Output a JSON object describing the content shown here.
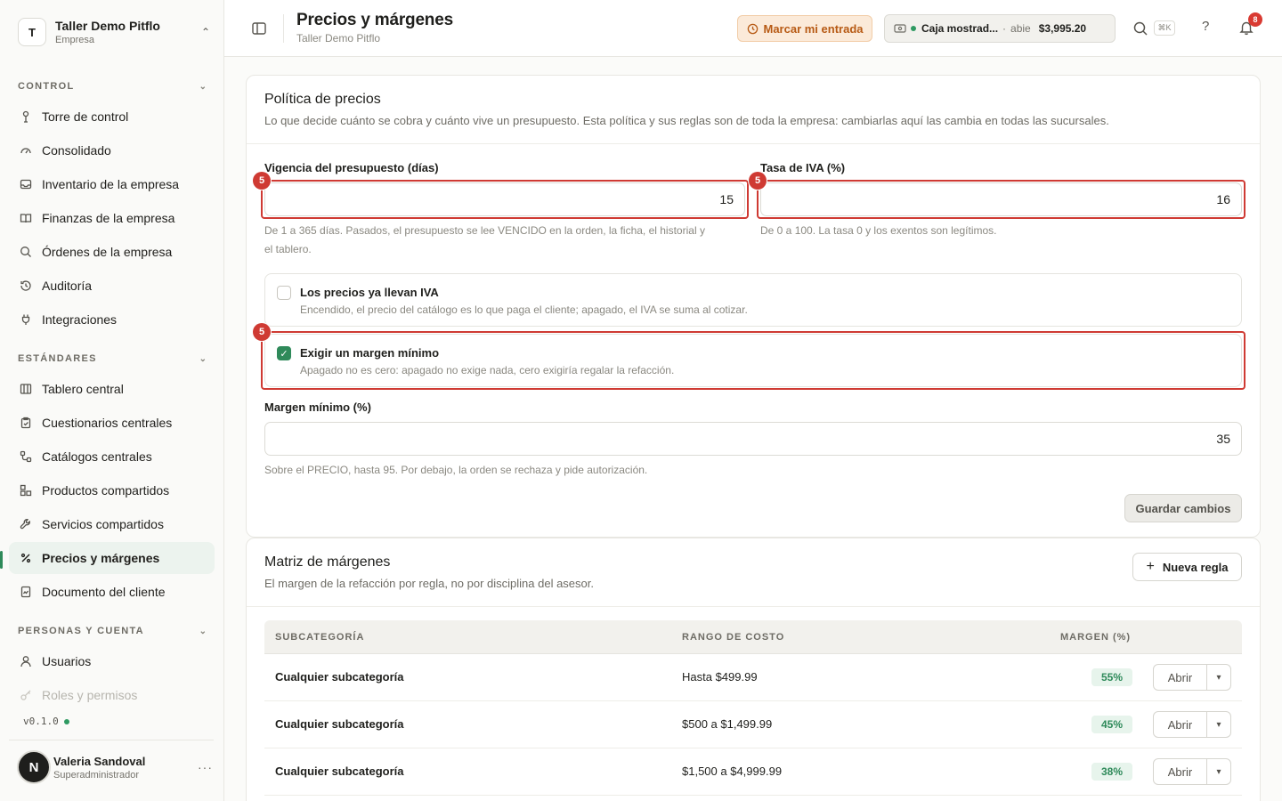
{
  "workspace": {
    "initial": "T",
    "name": "Taller Demo Pitflo",
    "type": "Empresa"
  },
  "sidebar": {
    "sections": [
      {
        "title": "CONTROL",
        "items": [
          {
            "label": "Torre de control",
            "icon": "tower-icon"
          },
          {
            "label": "Consolidado",
            "icon": "gauge-icon"
          },
          {
            "label": "Inventario de la empresa",
            "icon": "inbox-icon"
          },
          {
            "label": "Finanzas de la empresa",
            "icon": "book-icon"
          },
          {
            "label": "Órdenes de la empresa",
            "icon": "search-icon"
          },
          {
            "label": "Auditoría",
            "icon": "history-icon"
          },
          {
            "label": "Integraciones",
            "icon": "plug-icon"
          }
        ]
      },
      {
        "title": "ESTÁNDARES",
        "items": [
          {
            "label": "Tablero central",
            "icon": "columns-icon"
          },
          {
            "label": "Cuestionarios centrales",
            "icon": "clipboard-icon"
          },
          {
            "label": "Catálogos centrales",
            "icon": "flow-icon"
          },
          {
            "label": "Productos compartidos",
            "icon": "boxes-icon"
          },
          {
            "label": "Servicios compartidos",
            "icon": "wrench-icon"
          },
          {
            "label": "Precios y márgenes",
            "icon": "percent-icon",
            "active": true
          },
          {
            "label": "Documento del cliente",
            "icon": "document-icon"
          }
        ]
      },
      {
        "title": "PERSONAS Y CUENTA",
        "items": [
          {
            "label": "Usuarios",
            "icon": "user-icon"
          },
          {
            "label": "Roles y permisos",
            "icon": "key-icon"
          }
        ]
      }
    ],
    "version": "v0.1.0",
    "user": {
      "initial": "N",
      "name": "Valeria Sandoval",
      "role": "Superadministrador"
    }
  },
  "header": {
    "title": "Precios y márgenes",
    "subtitle": "Taller Demo Pitflo",
    "clock_in_label": "Marcar mi entrada",
    "register": {
      "name": "Caja mostrad...",
      "separator": "·",
      "status": "abie",
      "amount": "$3,995.20"
    },
    "shortcut": "⌘K",
    "help": "?",
    "notifications": "8"
  },
  "policy": {
    "title": "Política de precios",
    "description": "Lo que decide cuánto se cobra y cuánto vive un presupuesto. Esta política y sus reglas son de toda la empresa: cambiarlas aquí las cambia en todas las sucursales.",
    "validity_label": "Vigencia del presupuesto (días)",
    "validity_value": "15",
    "validity_help_1": "De 1 a 365 días. Pasados, el presupuesto se lee VENCIDO en la orden, la ficha, el historial y",
    "validity_help_2": "el tablero.",
    "vat_label": "Tasa de IVA (%)",
    "vat_value": "16",
    "vat_help": "De 0 a 100. La tasa 0 y los exentos son legítimos.",
    "prices_include_vat": {
      "title": "Los precios ya llevan IVA",
      "description": "Encendido, el precio del catálogo es lo que paga el cliente; apagado, el IVA se suma al cotizar.",
      "checked": false
    },
    "require_min_margin": {
      "title": "Exigir un margen mínimo",
      "description": "Apagado no es cero: apagado no exige nada, cero exigiría regalar la refacción.",
      "checked": true
    },
    "min_margin_label": "Margen mínimo (%)",
    "min_margin_value": "35",
    "min_margin_help": "Sobre el PRECIO, hasta 95. Por debajo, la orden se rechaza y pide autorización.",
    "save_label": "Guardar cambios",
    "marker": "5"
  },
  "matrix": {
    "title": "Matriz de márgenes",
    "description": "El margen de la refacción por regla, no por disciplina del asesor.",
    "new_rule_label": "Nueva regla",
    "columns": [
      "SUBCATEGORÍA",
      "RANGO DE COSTO",
      "MARGEN (%)"
    ],
    "open_label": "Abrir",
    "rows": [
      {
        "subcategory": "Cualquier subcategoría",
        "range": "Hasta $499.99",
        "margin": "55%"
      },
      {
        "subcategory": "Cualquier subcategoría",
        "range": "$500 a $1,499.99",
        "margin": "45%"
      },
      {
        "subcategory": "Cualquier subcategoría",
        "range": "$1,500 a $4,999.99",
        "margin": "38%"
      }
    ]
  },
  "colors": {
    "accent": "#2f8a5a",
    "highlight": "#cf3a33",
    "warning": "#b75a14"
  }
}
